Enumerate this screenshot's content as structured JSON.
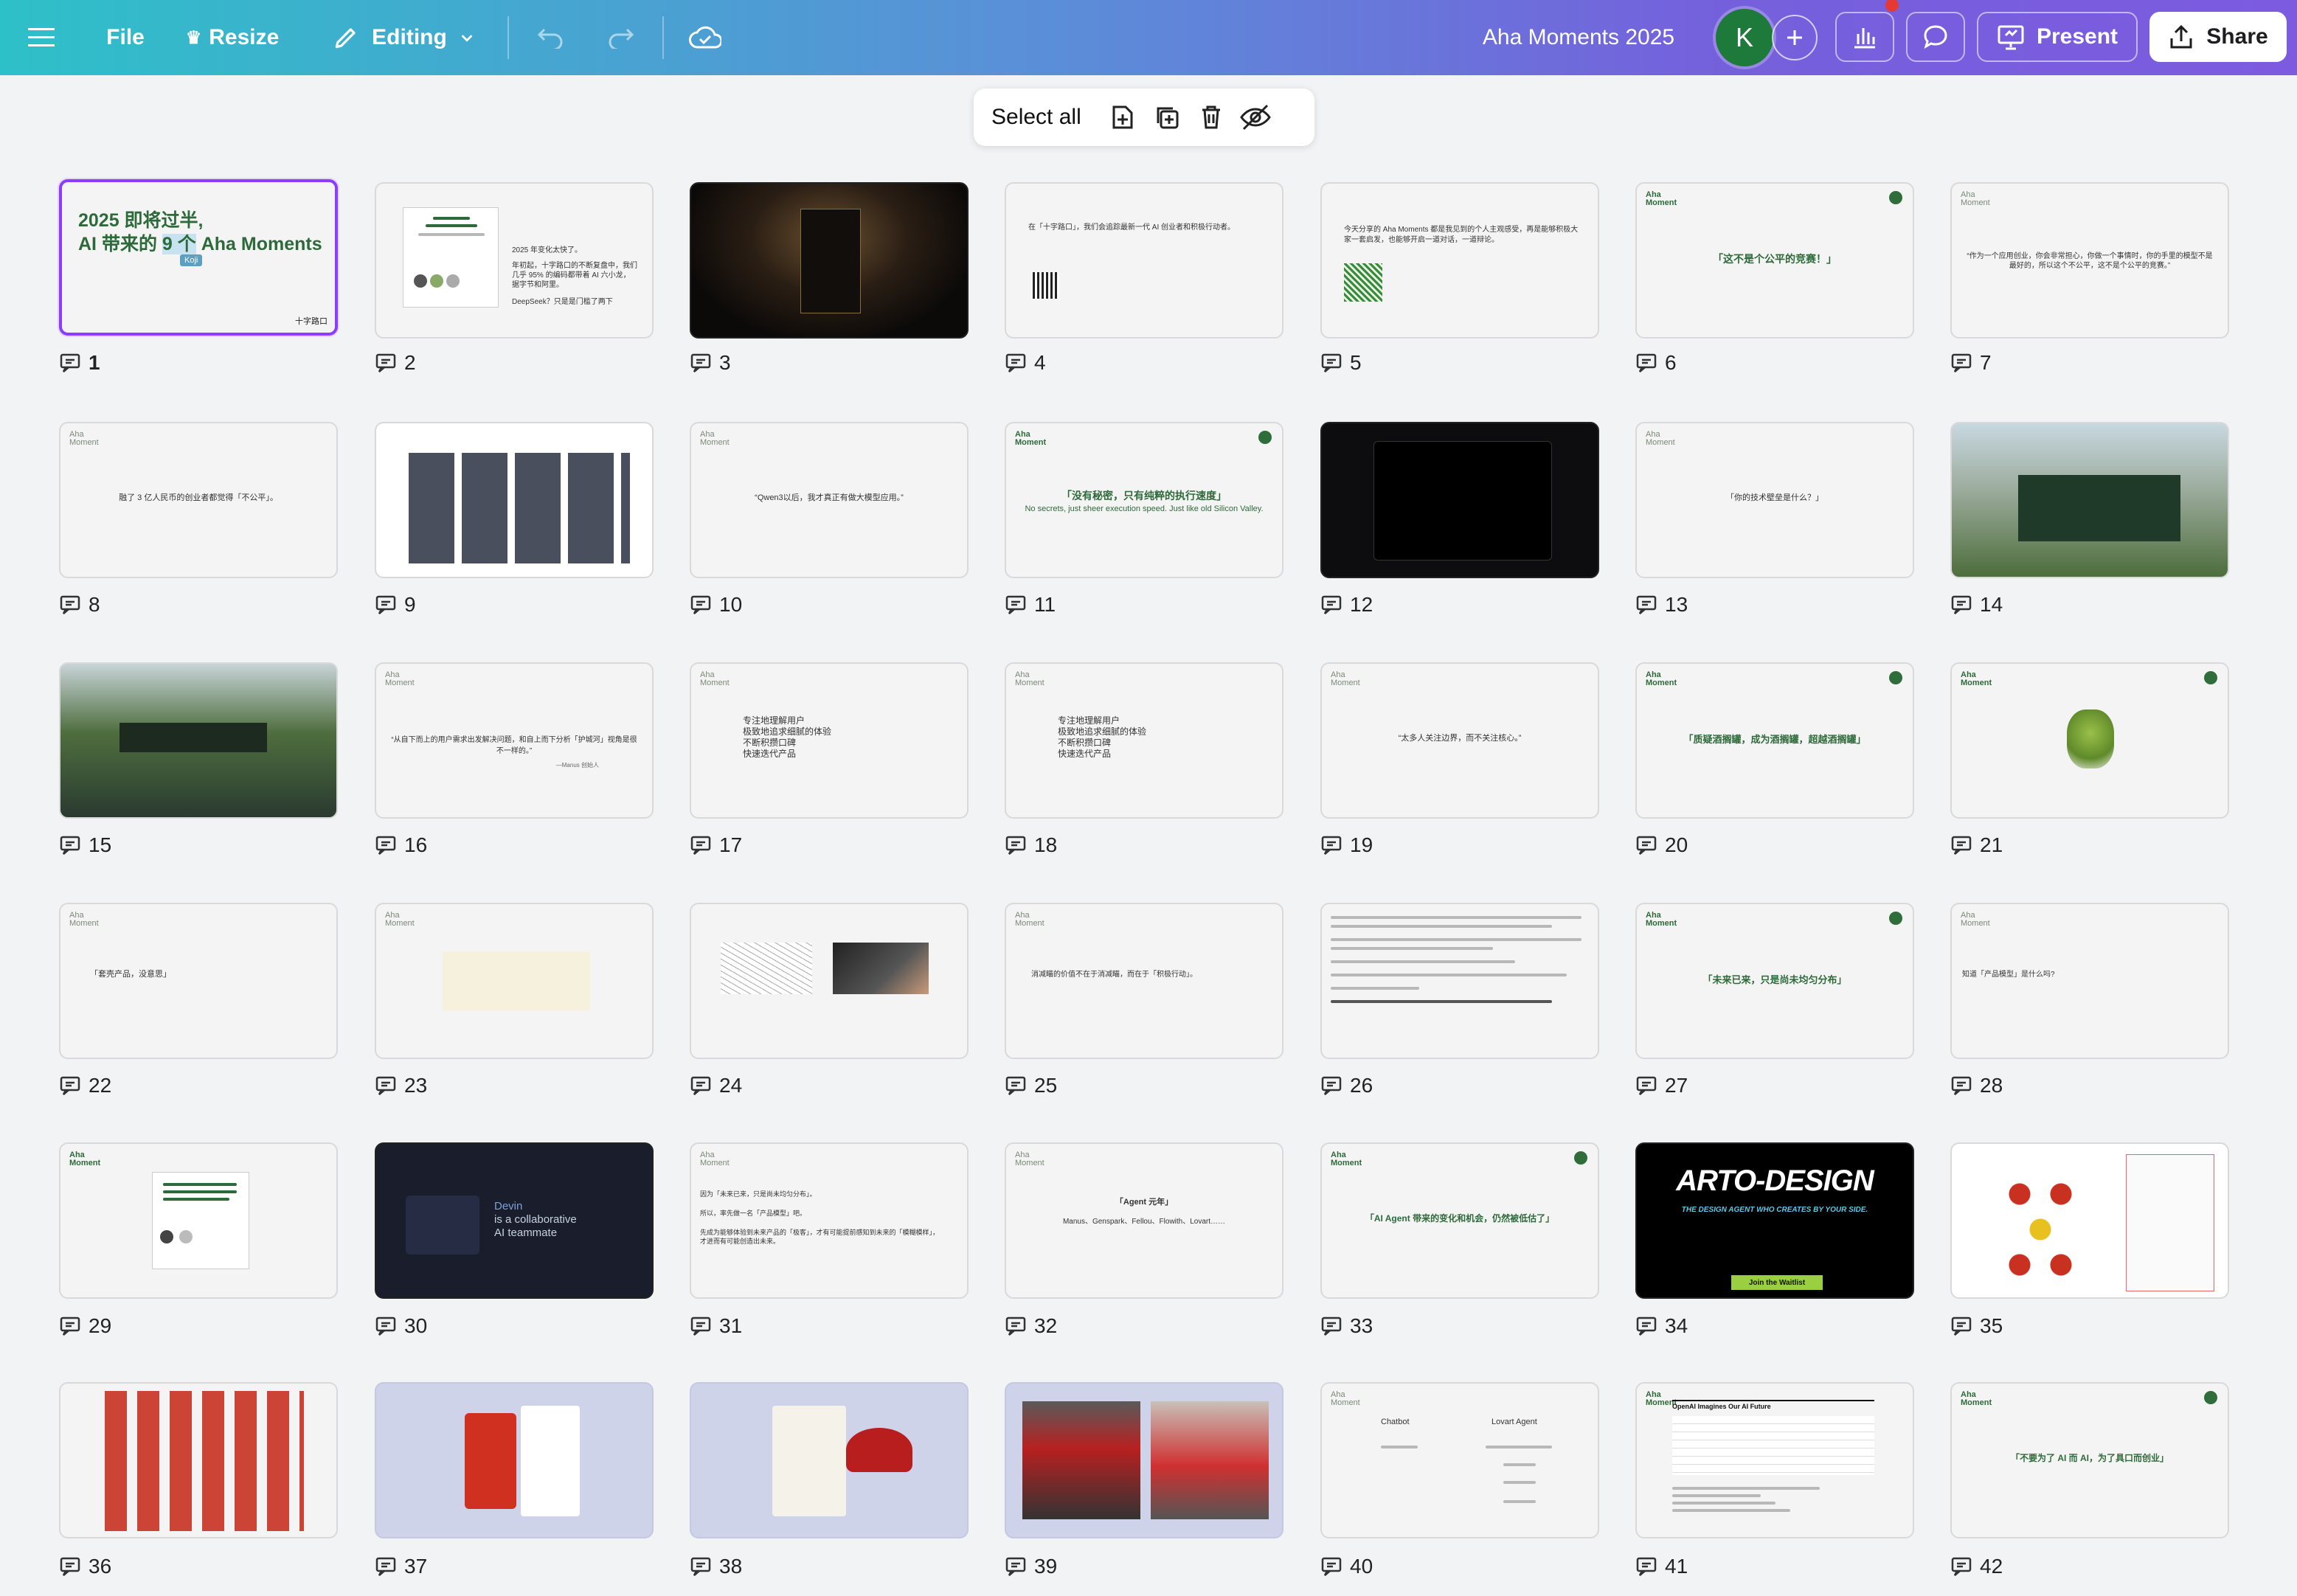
{
  "topbar": {
    "file": "File",
    "resize": "Resize",
    "editing": "Editing",
    "doc_title": "Aha Moments 2025",
    "avatar_initial": "K",
    "present": "Present",
    "share": "Share"
  },
  "selection_bar": {
    "select_all": "Select all"
  },
  "slide1": {
    "line1": "2025 即将过半,",
    "line2_pre": "AI 带来的 ",
    "line2_hl": "9 个",
    "line2_post": " Aha Moments",
    "tag": "Koji",
    "logo": "十字路口"
  },
  "slide2": {
    "l1": "2025 年变化太快了。",
    "l2": "年初起，十字路口的不断复盘中，我们",
    "l3": "几乎 95% 的编码都带着 AI 六小龙，",
    "l4": "据字节和阿里。",
    "l5": "DeepSeek？只是是门槛了两下"
  },
  "slide4": {
    "text": "在「十字路口」，我们会追踪最新一代 AI 创业者和积极行动者。"
  },
  "slide5": {
    "text": "今天分享的 Aha Moments 都是我见到的个人主观感受，再是能够积极大家一套启发，也能够开启一道对话，一道辩论。"
  },
  "slides_text": {
    "aha": "Aha",
    "moment": "Moment",
    "s6": "「这不是个公平的竞赛！」",
    "s7": "“作为一个应用创业，你会非常担心，你做一个事情时，你的手里的模型不是最好的，所以这个不公平，这不是个公平的竞赛。”",
    "s8": "融了 3 亿人民币的创业者都觉得「不公平」。",
    "s10": "“Qwen3以后，我才真正有做大模型应用。”",
    "s11": "「没有秘密，只有纯粹的执行速度」",
    "s11_sub": "No secrets, just sheer execution speed. Just like old Silicon Valley.",
    "s13": "「你的技术壁垒是什么？」",
    "s16": "“从自下而上的用户需求出发解决问题，和自上而下分析「护城河」视角是很不一样的。”",
    "s16_by": "—Manus 创始人",
    "s17": [
      "专注地理解用户",
      "极致地追求细腻的体验",
      "不断积攒口碑",
      "快速迭代产品"
    ],
    "s19": "“太多人关注边界，而不关注核心。”",
    "s20": "「质疑酒搁罐，成为酒搁罐，超越酒搁罐」",
    "s22": "「套壳产品，没意思」",
    "s25": "消减瞄的价值不在于消减瞄，而在于「积极行动」。",
    "s27": "「未来已来，只是尚未均匀分布」",
    "s28": "知道「产品模型」是什么吗?",
    "s30_title": "Devin",
    "s30_l2": "is a collaborative",
    "s30_l3": "AI teammate",
    "s31_l1": "因为「未来已来，只是尚未均匀分布」。",
    "s31_l2": "所以，率先做一名「产品模型」吧。",
    "s31_l3": "先成为能够体验到未来产品的「极客」，才有可能提前感知到未来的「模糊模样」，才进而有可能创造出未来。",
    "s32": "「Agent 元年」",
    "s32_sub": "Manus、Genspark、Fellou、Flowith、Lovart……",
    "s33": "「AI Agent 带来的变化和机会，仍然被低估了」",
    "s34_title": "ARTO-DESIGN",
    "s34_sub": "THE DESIGN AGENT WHO CREATES BY YOUR SIDE.",
    "s34_btn": "Join the Waitlist",
    "s40_left": "Chatbot",
    "s40_right": "Lovart Agent",
    "s41_title": "OpenAI Imagines Our AI Future",
    "s42": "「不要为了 AI 而 AI，为了具口而创业」"
  },
  "slide_numbers": [
    1,
    2,
    3,
    4,
    5,
    6,
    7,
    8,
    9,
    10,
    11,
    12,
    13,
    14,
    15,
    16,
    17,
    18,
    19,
    20,
    21,
    22,
    23,
    24,
    25,
    26,
    27,
    28,
    29,
    30,
    31,
    32,
    33,
    34,
    35,
    36,
    37,
    38,
    39,
    40,
    41,
    42
  ],
  "colors": {
    "accent_purple": "#8b3dff",
    "aha_green": "#2d6a3a",
    "avatar_green": "#1e7a3a"
  }
}
